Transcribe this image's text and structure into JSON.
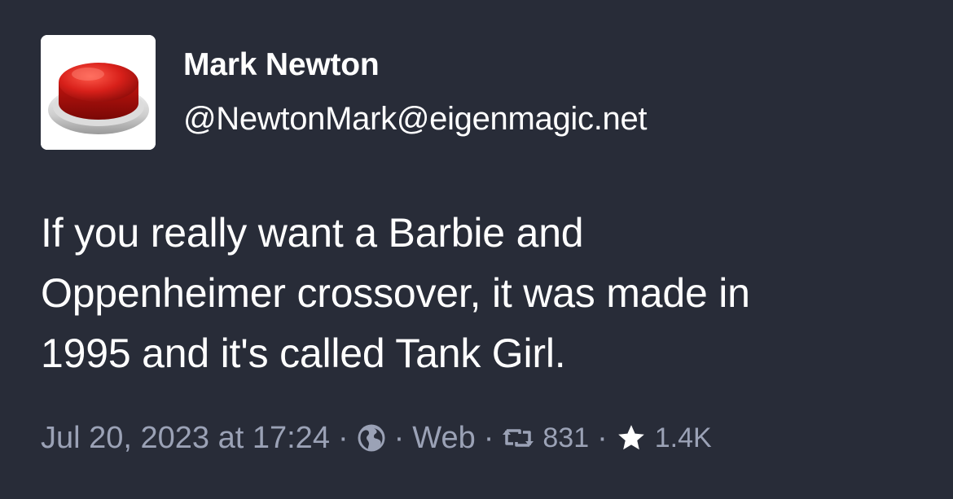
{
  "author": {
    "display_name": "Mark Newton",
    "handle": "@NewtonMark@eigenmagic.net",
    "avatar_icon": "red-button-avatar"
  },
  "status": {
    "lines": [
      "If you really want a Barbie and",
      "Oppenheimer crossover, it was made in",
      "1995 and it's called Tank Girl."
    ]
  },
  "meta": {
    "timestamp": "Jul 20, 2023 at 17:24",
    "separator": "·",
    "visibility_icon": "globe-icon",
    "application": "Web",
    "reblog_icon": "reblog-icon",
    "reblog_count": "831",
    "favourite_icon": "star-icon",
    "favourite_count": "1.4K"
  },
  "colors": {
    "background": "#282c38",
    "text": "#ffffff",
    "meta_text": "#9ba2b6"
  }
}
